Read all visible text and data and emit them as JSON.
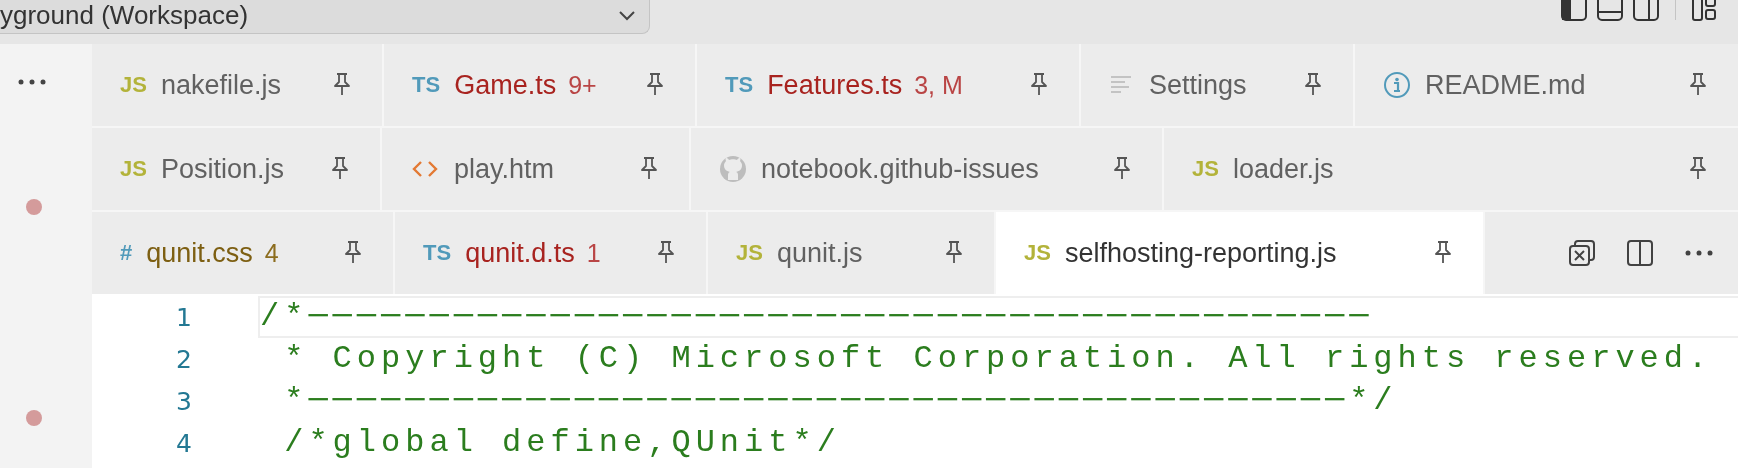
{
  "workspace_picker": {
    "value": "yground (Workspace)"
  },
  "tab_rows": [
    {
      "tabs": [
        {
          "kind": "js",
          "icon_text": "JS",
          "label": "nakefile.js",
          "error": false,
          "warning": false,
          "pinned": true,
          "selected": false
        },
        {
          "kind": "ts",
          "icon_text": "TS",
          "label": "Game.ts",
          "badge": "9+",
          "error": true,
          "warning": false,
          "pinned": true,
          "selected": false
        },
        {
          "kind": "ts",
          "icon_text": "TS",
          "label": "Features.ts",
          "badge": "3, M",
          "error": true,
          "warning": false,
          "pinned": true,
          "selected": false
        },
        {
          "kind": "settings",
          "label": "Settings",
          "error": false,
          "warning": false,
          "pinned": true,
          "selected": false
        },
        {
          "kind": "info",
          "label": "README.md",
          "error": false,
          "warning": false,
          "pinned": true,
          "selected": false
        }
      ]
    },
    {
      "tabs": [
        {
          "kind": "js",
          "icon_text": "JS",
          "label": "Position.js",
          "error": false,
          "warning": false,
          "pinned": true,
          "selected": false
        },
        {
          "kind": "html",
          "label": "play.htm",
          "error": false,
          "warning": false,
          "pinned": true,
          "selected": false
        },
        {
          "kind": "github",
          "label": "notebook.github-issues",
          "error": false,
          "warning": false,
          "pinned": true,
          "selected": false
        },
        {
          "kind": "js",
          "icon_text": "JS",
          "label": "loader.js",
          "error": false,
          "warning": false,
          "pinned": true,
          "selected": false
        }
      ]
    },
    {
      "tabs": [
        {
          "kind": "css",
          "icon_text": "#",
          "label": "qunit.css",
          "badge": "4",
          "error": false,
          "warning": true,
          "pinned": true,
          "selected": false
        },
        {
          "kind": "ts",
          "icon_text": "TS",
          "label": "qunit.d.ts",
          "badge": "1",
          "error": true,
          "warning": false,
          "pinned": true,
          "selected": false
        },
        {
          "kind": "js",
          "icon_text": "JS",
          "label": "qunit.js",
          "error": false,
          "warning": false,
          "pinned": true,
          "selected": false
        },
        {
          "kind": "js",
          "icon_text": "JS",
          "label": "selfhosting-reporting.js",
          "error": false,
          "warning": false,
          "pinned": true,
          "selected": true
        }
      ]
    }
  ],
  "editor": {
    "lines": [
      {
        "number": "1",
        "text": "/*────────────────────────────────────────────",
        "current": true
      },
      {
        "number": "2",
        "text": " * Copyright (C) Microsoft Corporation. All rights reserved.",
        "current": false
      },
      {
        "number": "3",
        "text": " *───────────────────────────────────────────*/",
        "current": false
      },
      {
        "number": "4",
        "text": " /*global define,QUnit*/",
        "current": false
      }
    ]
  }
}
